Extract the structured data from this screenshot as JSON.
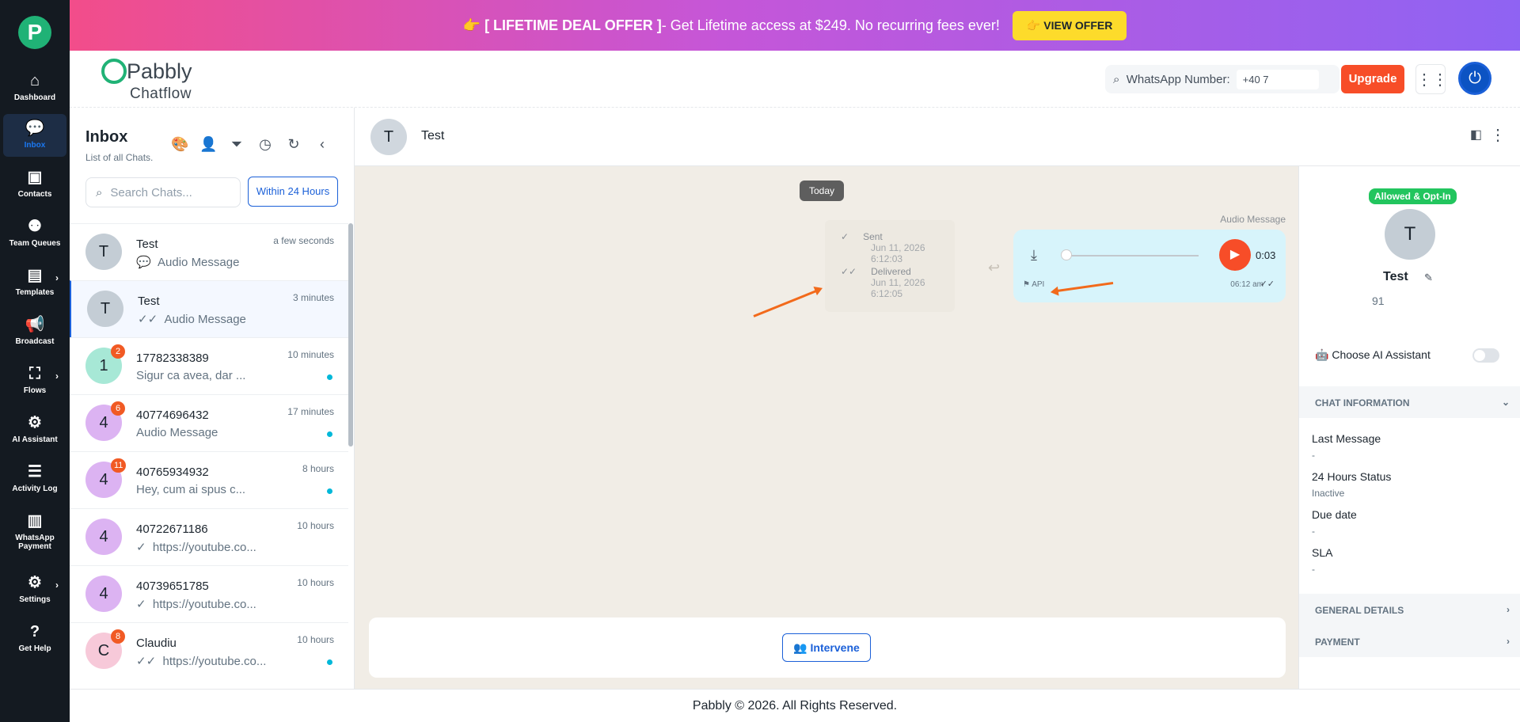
{
  "nav": [
    {
      "label": "Dashboard",
      "icon": "home-icon"
    },
    {
      "label": "Inbox",
      "icon": "chat-icon"
    },
    {
      "label": "Contacts",
      "icon": "contacts-icon"
    },
    {
      "label": "Team Queues",
      "icon": "team-icon"
    },
    {
      "label": "Templates",
      "icon": "templates-icon"
    },
    {
      "label": "Broadcast",
      "icon": "megaphone-icon"
    },
    {
      "label": "Flows",
      "icon": "flows-icon"
    },
    {
      "label": "AI Assistant",
      "icon": "ai-icon"
    },
    {
      "label": "Activity Log",
      "icon": "activity-icon"
    },
    {
      "label": "WhatsApp Payment",
      "icon": "payment-icon"
    },
    {
      "label": "Settings",
      "icon": "gear-icon"
    },
    {
      "label": "Get Help",
      "icon": "help-icon"
    }
  ],
  "banner": {
    "emoji": "👉",
    "bold_text": "[ LIFETIME DEAL OFFER ]",
    "text": " - Get Lifetime access at $249. No recurring fees ever!",
    "button": "VIEW OFFER"
  },
  "header": {
    "brand": "Pabbly",
    "brand_sub": "Chatflow",
    "wa_label": "WhatsApp Number:",
    "wa_number": "+40 7",
    "upgrade": "Upgrade"
  },
  "inbox": {
    "title": "Inbox",
    "subtitle": "List of all Chats.",
    "search_placeholder": "Search Chats...",
    "filter": "Within 24 Hours",
    "chats": [
      {
        "initial": "T",
        "name": "Test",
        "message": "Audio Message",
        "time": "a few seconds",
        "badge": "",
        "color": "#c4cdd5",
        "prefix": "💬"
      },
      {
        "initial": "T",
        "name": "Test",
        "message": "Audio Message",
        "time": "3 minutes",
        "badge": "",
        "color": "#c4cdd5",
        "prefix": "✓✓"
      },
      {
        "initial": "1",
        "name": "17782338389",
        "message": "Sigur ca avea, dar ...",
        "time": "10 minutes",
        "badge": "2",
        "color": "#a7e8d6",
        "prefix": ""
      },
      {
        "initial": "4",
        "name": "40774696432",
        "message": "Audio Message",
        "time": "17 minutes",
        "badge": "6",
        "color": "#dcb3f2",
        "prefix": ""
      },
      {
        "initial": "4",
        "name": "40765934932",
        "message": "Hey, cum ai spus c...",
        "time": "8 hours",
        "badge": "11",
        "color": "#dcb3f2",
        "prefix": ""
      },
      {
        "initial": "4",
        "name": "40722671186",
        "message": "https://youtube.co...",
        "time": "10 hours",
        "badge": "",
        "color": "#dcb3f2",
        "prefix": "✓"
      },
      {
        "initial": "4",
        "name": "40739651785",
        "message": "https://youtube.co...",
        "time": "10 hours",
        "badge": "",
        "color": "#dcb3f2",
        "prefix": "✓"
      },
      {
        "initial": "C",
        "name": "Claudiu",
        "message": "https://youtube.co...",
        "time": "10 hours",
        "badge": "8",
        "color": "#f7c9d9",
        "prefix": "✓✓"
      }
    ]
  },
  "chat": {
    "name": "Test",
    "initial": "T",
    "day": "Today",
    "sent_label": "Sent",
    "sent_time": "Jun 11, 2026 6:12:03",
    "delivered_label": "Delivered",
    "delivered_time": "Jun 11, 2026 6:12:05",
    "audio_label": "Audio Message",
    "duration": "0:03",
    "api": "API",
    "msg_time": "06:12 am",
    "intervene": "Intervene"
  },
  "contact": {
    "status": "Allowed & Opt-In",
    "initial": "T",
    "name": "Test",
    "phone": "91",
    "ai_label": "Choose AI Assistant",
    "chat_info": "CHAT INFORMATION",
    "fields": [
      {
        "label": "Last Message",
        "value": "-"
      },
      {
        "label": "24 Hours Status",
        "value": "Inactive"
      },
      {
        "label": "Due date",
        "value": "-"
      },
      {
        "label": "SLA",
        "value": "-"
      }
    ],
    "general": "GENERAL DETAILS",
    "payment": "PAYMENT"
  },
  "footer": "Pabbly © 2026. All Rights Reserved."
}
